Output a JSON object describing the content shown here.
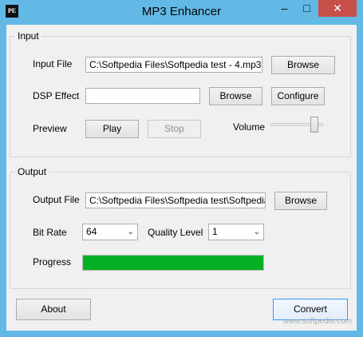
{
  "window": {
    "title": "MP3 Enhancer",
    "icon_text": "PE",
    "controls": {
      "minimize": "–",
      "maximize": "□",
      "close": "✕"
    }
  },
  "input_group": {
    "title": "Input",
    "input_file_label": "Input File",
    "input_file_value": "C:\\Softpedia Files\\Softpedia test - 4.mp3",
    "browse_label": "Browse",
    "dsp_label": "DSP Effect",
    "dsp_value": "",
    "dsp_browse_label": "Browse",
    "configure_label": "Configure",
    "preview_label": "Preview",
    "play_label": "Play",
    "stop_label": "Stop",
    "volume_label": "Volume",
    "volume_level": 0.9
  },
  "output_group": {
    "title": "Output",
    "output_file_label": "Output File",
    "output_file_value": "C:\\Softpedia Files\\Softpedia test\\Softpedia te",
    "browse_label": "Browse",
    "bitrate_label": "Bit Rate",
    "bitrate_value": "64",
    "quality_label": "Quality Level",
    "quality_value": "1",
    "progress_label": "Progress",
    "progress_value": 1.0
  },
  "footer": {
    "about_label": "About",
    "convert_label": "Convert"
  },
  "watermark": "www.softpedia.com",
  "colors": {
    "titlebar": "#62b9e6",
    "close": "#c7504a",
    "progress": "#06b025"
  }
}
